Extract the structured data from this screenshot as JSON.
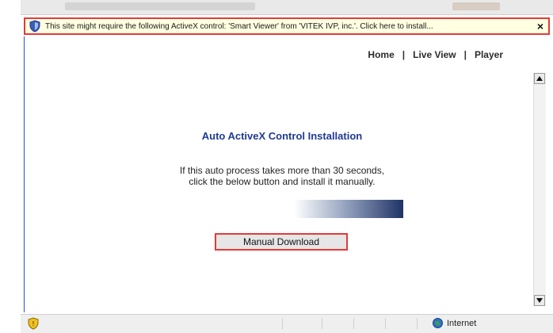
{
  "infobar": {
    "message": "This site might require the following ActiveX control: 'Smart Viewer' from 'VITEK IVP, inc.'.  Click here to install...",
    "close_label": "×"
  },
  "nav": {
    "home": "Home",
    "sep1": "|",
    "live_view": "Live View",
    "sep2": "|",
    "player": "Player"
  },
  "main": {
    "title": "Auto ActiveX Control Installation",
    "line1": "If this auto process takes more than 30 seconds,",
    "line2": "click the below button and install it manually.",
    "manual_button": "Manual Download"
  },
  "status": {
    "zone": "Internet"
  },
  "colors": {
    "infobar_bg": "#ffffe1",
    "highlight_border": "#e53a3a",
    "title_blue": "#1f3a93"
  },
  "icons": {
    "infobar": "shield-icon",
    "close": "close-icon",
    "scroll_up": "scroll-up-arrow-icon",
    "scroll_down": "scroll-down-arrow-icon",
    "status": "shield-icon",
    "zone": "globe-icon"
  }
}
